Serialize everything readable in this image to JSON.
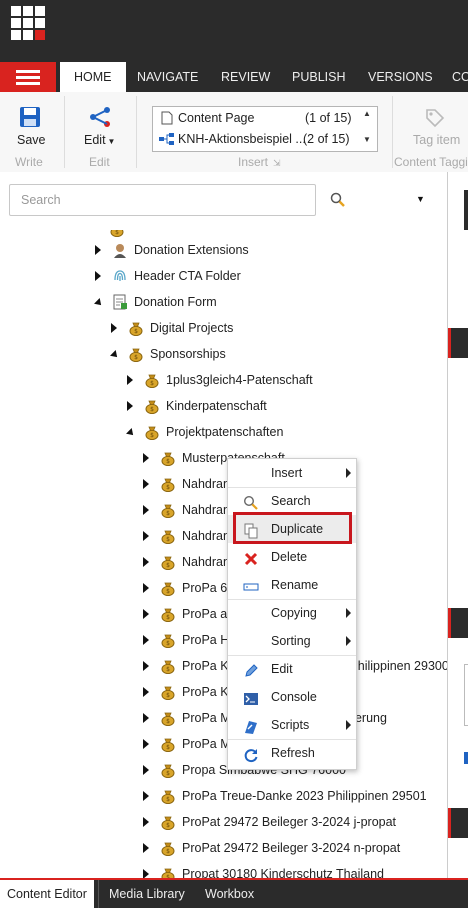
{
  "ribbon": {
    "tabs": [
      "HOME",
      "NAVIGATE",
      "REVIEW",
      "PUBLISH",
      "VERSIONS",
      "CO"
    ],
    "save_label": "Save",
    "write_group": "Write",
    "edit_label": "Edit",
    "edit_group": "Edit",
    "gallery": [
      {
        "label": "Content Page",
        "count": "(1 of 15)"
      },
      {
        "label": "KNH-Aktionsbeispiel ...",
        "count": "(2 of 15)"
      }
    ],
    "insert_group": "Insert",
    "tag_item_label": "Tag item",
    "content_tagging_group": "Content Taggi"
  },
  "search": {
    "placeholder": "Search"
  },
  "tree": [
    {
      "label": "Donation Extensions",
      "icon": "avatar-icon",
      "expander": "right"
    },
    {
      "label": "Header CTA Folder",
      "icon": "fingerprint-icon",
      "expander": "right"
    },
    {
      "label": "Donation Form",
      "icon": "form-icon",
      "expander": "down"
    },
    {
      "label": "Digital Projects",
      "icon": "moneybag-icon",
      "expander": "right"
    },
    {
      "label": "Sponsorships",
      "icon": "moneybag-icon",
      "expander": "down"
    },
    {
      "label": "1plus3gleich4-Patenschaft",
      "icon": "moneybag-icon",
      "expander": "right"
    },
    {
      "label": "Kinderpatenschaft",
      "icon": "moneybag-icon",
      "expander": "right"
    },
    {
      "label": "Projektpatenschaften",
      "icon": "moneybag-icon",
      "expander": "down"
    },
    {
      "label": "Musterpatenschaft",
      "icon": "moneybag-icon",
      "expander": "right"
    },
    {
      "label": "Nahdrang",
      "icon": "moneybag-icon",
      "expander": "right"
    },
    {
      "label": "Nahdrang",
      "icon": "moneybag-icon",
      "expander": "right"
    },
    {
      "label": "Nahdrang",
      "icon": "moneybag-icon",
      "expander": "right"
    },
    {
      "label": "Nahdrang",
      "icon": "moneybag-icon",
      "expander": "right"
    },
    {
      "label": "ProPa 60",
      "icon": "moneybag-icon",
      "expander": "right"
    },
    {
      "label": "ProPa all",
      "icon": "moneybag-icon",
      "expander": "right"
    },
    {
      "label": "ProPa Ho",
      "icon": "moneybag-icon",
      "expander": "right"
    },
    {
      "label": "ProPa Kin                                Philippinen 29300",
      "icon": "moneybag-icon",
      "expander": "right"
    },
    {
      "label": "ProPa Kli",
      "icon": "moneybag-icon",
      "expander": "right"
    },
    {
      "label": "ProPa Ma                                 lerung",
      "icon": "moneybag-icon",
      "expander": "right"
    },
    {
      "label": "ProPa My",
      "icon": "moneybag-icon",
      "expander": "right"
    },
    {
      "label": "Propa Simbabwe SHG 76000",
      "icon": "moneybag-icon",
      "expander": "right"
    },
    {
      "label": "ProPa Treue-Danke 2023 Philippinen 29501",
      "icon": "moneybag-icon",
      "expander": "right"
    },
    {
      "label": "ProPat 29472 Beileger 3-2024 j-propat",
      "icon": "moneybag-icon",
      "expander": "right"
    },
    {
      "label": "ProPat 29472 Beileger 3-2024 n-propat",
      "icon": "moneybag-icon",
      "expander": "right"
    },
    {
      "label": "Propat 30180 Kinderschutz Thailand",
      "icon": "moneybag-icon",
      "expander": "right"
    }
  ],
  "context_menu": [
    {
      "label": "Insert",
      "icon": "",
      "submenu": true
    },
    {
      "label": "Search",
      "icon": "search-icon",
      "submenu": false
    },
    {
      "label": "Duplicate",
      "icon": "duplicate-icon",
      "submenu": false,
      "highlighted": true
    },
    {
      "label": "Delete",
      "icon": "delete-icon",
      "submenu": false
    },
    {
      "label": "Rename",
      "icon": "rename-icon",
      "submenu": false
    },
    {
      "label": "Copying",
      "icon": "",
      "submenu": true
    },
    {
      "label": "Sorting",
      "icon": "",
      "submenu": true
    },
    {
      "label": "Edit",
      "icon": "edit-icon",
      "submenu": false
    },
    {
      "label": "Console",
      "icon": "console-icon",
      "submenu": false
    },
    {
      "label": "Scripts",
      "icon": "scripts-icon",
      "submenu": true
    },
    {
      "label": "Refresh",
      "icon": "refresh-icon",
      "submenu": false
    }
  ],
  "bottom_tabs": [
    "Content Editor",
    "Media Library",
    "Workbox"
  ],
  "colors": {
    "accent": "#d9231f",
    "dark": "#2b2b2b",
    "highlight": "#c8161d"
  }
}
